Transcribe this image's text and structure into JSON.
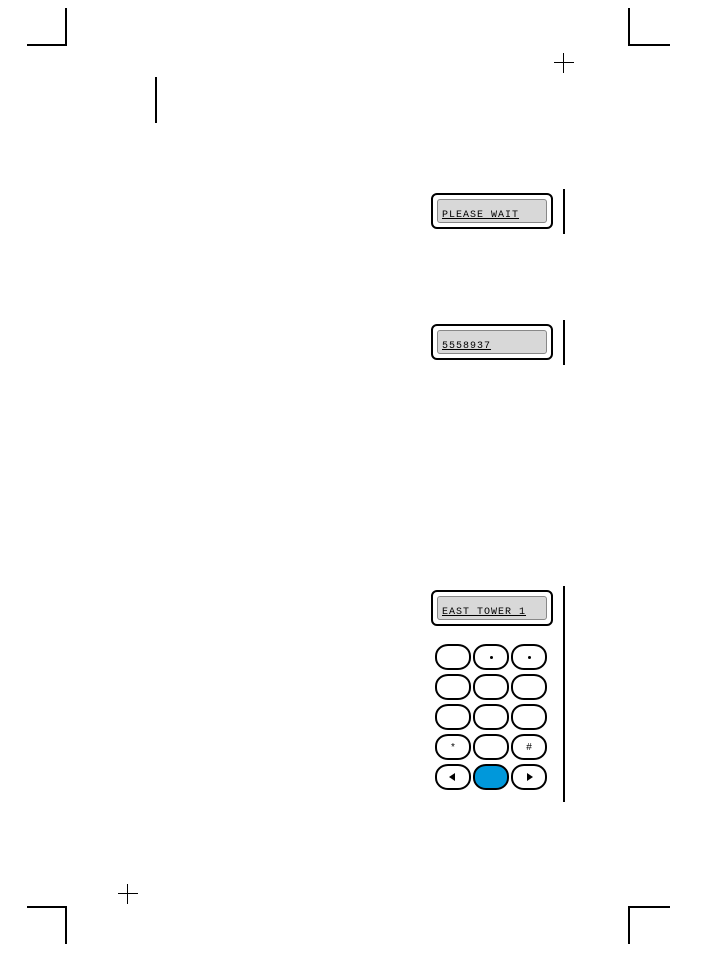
{
  "lcd1": {
    "text": "PLEASE WAIT"
  },
  "lcd2": {
    "text": "5558937"
  },
  "lcd3": {
    "text": "EAST TOWER 1"
  },
  "keypad": {
    "keys": [
      {
        "name": "key-1",
        "label": "",
        "interact": true
      },
      {
        "name": "key-2",
        "label": "",
        "dot": true,
        "interact": true
      },
      {
        "name": "key-3",
        "label": "",
        "dot": true,
        "interact": true
      },
      {
        "name": "key-4",
        "label": "",
        "interact": true
      },
      {
        "name": "key-5",
        "label": "",
        "interact": true
      },
      {
        "name": "key-6",
        "label": "",
        "interact": true
      },
      {
        "name": "key-7",
        "label": "",
        "interact": true
      },
      {
        "name": "key-8",
        "label": "",
        "interact": true
      },
      {
        "name": "key-9",
        "label": "",
        "interact": true
      },
      {
        "name": "key-star",
        "label": "*",
        "interact": true
      },
      {
        "name": "key-0",
        "label": "",
        "interact": true
      },
      {
        "name": "key-hash",
        "label": "#",
        "interact": true
      },
      {
        "name": "key-left",
        "arrow": "left",
        "interact": true
      },
      {
        "name": "key-center",
        "blue": true,
        "interact": true
      },
      {
        "name": "key-right",
        "arrow": "right",
        "interact": true
      }
    ]
  }
}
